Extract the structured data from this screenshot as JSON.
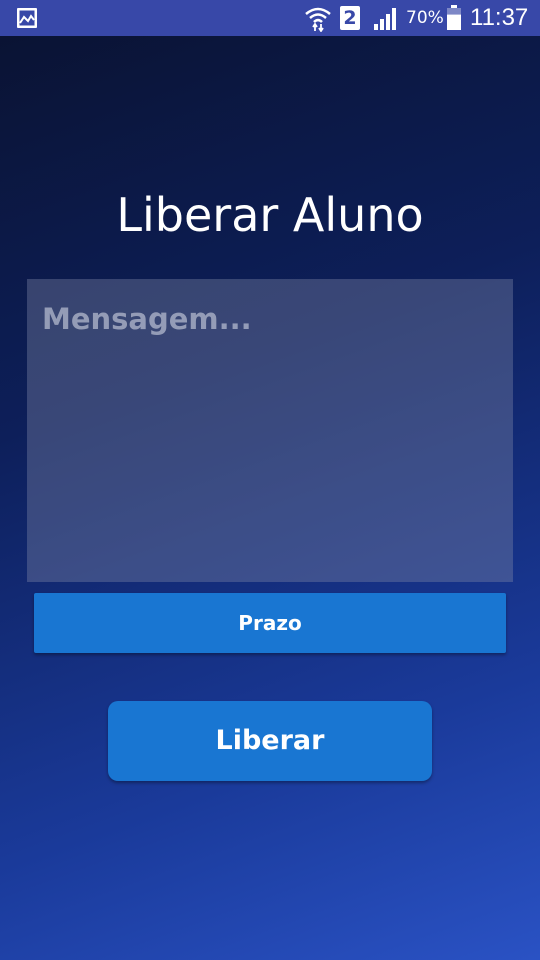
{
  "status_bar": {
    "notification_icon": "gallery-icon",
    "wifi_icon": "wifi-icon",
    "sim_label": "2",
    "signal_icon": "signal-icon",
    "battery_percent": "70%",
    "battery_icon": "battery-icon",
    "battery_level": 0.7,
    "time": "11:37"
  },
  "screen": {
    "title": "Liberar Aluno"
  },
  "message": {
    "placeholder": "Mensagem...",
    "value": ""
  },
  "buttons": {
    "prazo_label": "Prazo",
    "liberar_label": "Liberar"
  },
  "colors": {
    "status_bar_bg": "#3848a8",
    "button_bg": "#1976d2",
    "background_dark": "#0a1230",
    "background_light": "#2a52c4"
  }
}
